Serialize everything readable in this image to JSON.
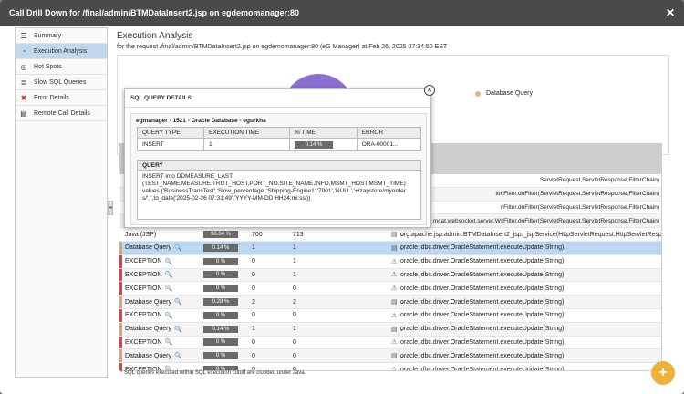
{
  "window": {
    "title": "Call Drill Down for /final/admin/BTMDataInsert2.jsp on egdemomanager:80",
    "close_icon": "close-icon"
  },
  "sidebar": {
    "items": [
      {
        "label": "Summary",
        "icon": "list-icon",
        "active": false
      },
      {
        "label": "Execution Analysis",
        "icon": "pie-chart-icon",
        "active": true
      },
      {
        "label": "Hot Spots",
        "icon": "target-icon",
        "active": false
      },
      {
        "label": "Slow SQL Queries",
        "icon": "database-icon",
        "active": false
      },
      {
        "label": "Error Details",
        "icon": "error-icon",
        "active": false
      },
      {
        "label": "Remote Call Details",
        "icon": "document-icon",
        "active": false
      }
    ]
  },
  "main": {
    "title": "Execution Analysis",
    "subtitle": "for the request /final/admin/BTMDataInsert2.jsp on egdemomanager:80 (eG Manager) at Feb 26, 2025 07:34:50 EST",
    "legend_label": "Database Query",
    "donut_color": "#8b6fd1",
    "footnote": "* SQL queries executed within SQL execution cutoff are clubbed under Java."
  },
  "table": {
    "top_stacks": [
      "ServletRequest,ServletResponse,FilterChain)",
      "ionFilter.doFilter(ServletRequest,ServletResponse,FilterChain)",
      "nFilter.doFilter(ServletRequest,ServletResponse,FilterChain)",
      "mcat.websocket.server.WsFilter.doFilter(ServletRequest,ServletResponse,FilterChain)"
    ],
    "rows": [
      {
        "type": "Java (JSP)",
        "kind": "java",
        "pct": "98.04 %",
        "c1": "700",
        "c2": "713",
        "stack": "org.apache.jsp.admin.BTMDataInsert2_jsp._jspService(HttpServletRequest,HttpServletResponse)",
        "selected": false
      },
      {
        "type": "Database Query",
        "kind": "db",
        "pct": "0.14 %",
        "c1": "1",
        "c2": "1",
        "stack": "oracle.jdbc.driver.OracleStatement.executeUpdate(String)",
        "selected": true
      },
      {
        "type": "EXCEPTION",
        "kind": "ex",
        "pct": "0 %",
        "c1": "0",
        "c2": "1",
        "stack": "oracle.jdbc.driver.OracleStatement.executeUpdate(String)",
        "selected": false
      },
      {
        "type": "EXCEPTION",
        "kind": "ex",
        "pct": "0 %",
        "c1": "0",
        "c2": "1",
        "stack": "oracle.jdbc.driver.OracleStatement.executeUpdate(String)",
        "selected": false
      },
      {
        "type": "EXCEPTION",
        "kind": "ex",
        "pct": "0 %",
        "c1": "0",
        "c2": "0",
        "stack": "oracle.jdbc.driver.OracleStatement.executeUpdate(String)",
        "selected": false
      },
      {
        "type": "Database Query",
        "kind": "db",
        "pct": "0.28 %",
        "c1": "2",
        "c2": "2",
        "stack": "oracle.jdbc.driver.OracleStatement.executeUpdate(String)",
        "selected": false
      },
      {
        "type": "EXCEPTION",
        "kind": "ex",
        "pct": "0 %",
        "c1": "0",
        "c2": "0",
        "stack": "oracle.jdbc.driver.OracleStatement.executeUpdate(String)",
        "selected": false
      },
      {
        "type": "Database Query",
        "kind": "db",
        "pct": "0.14 %",
        "c1": "1",
        "c2": "1",
        "stack": "oracle.jdbc.driver.OracleStatement.executeUpdate(String)",
        "selected": false
      },
      {
        "type": "EXCEPTION",
        "kind": "ex",
        "pct": "0 %",
        "c1": "0",
        "c2": "0",
        "stack": "oracle.jdbc.driver.OracleStatement.executeUpdate(String)",
        "selected": false
      },
      {
        "type": "Database Query",
        "kind": "db",
        "pct": "0 %",
        "c1": "0",
        "c2": "0",
        "stack": "oracle.jdbc.driver.OracleStatement.executeUpdate(String)",
        "selected": false
      },
      {
        "type": "EXCEPTION",
        "kind": "ex",
        "pct": "0 %",
        "c1": "0",
        "c2": "0",
        "stack": "oracle.jdbc.driver.OracleStatement.executeUpdate(String)",
        "selected": false
      }
    ]
  },
  "popup": {
    "title": "SQL QUERY DETAILS",
    "db_name": "egmanager - 1521 - Oracle Database - egurkha",
    "headers": [
      "QUERY TYPE",
      "EXECUTION TIME",
      "% TIME",
      "ERROR"
    ],
    "row": {
      "query_type": "INSERT",
      "exec_time": "1",
      "pct": "0.14 %",
      "error": "ORA-00001..."
    },
    "query_label": "QUERY",
    "query_text": "INSERT into DDMEASURE_LAST\n(TEST_NAME,MEASURE,TRGT_HOST,PORT_NO,SITE_NAME,INFO,MSMT_HOST,MSMT_TIME)\nvalues ('BusinessTransTest','Slow_percentage','Shipping-Engine1','7001','NULL','+/zapstore/myorders/','',to_date('2025-02-26 07:31:49','YYYY-MM-DD HH24:mi:ss'))"
  },
  "fab": {
    "icon": "zoom-in-icon"
  }
}
